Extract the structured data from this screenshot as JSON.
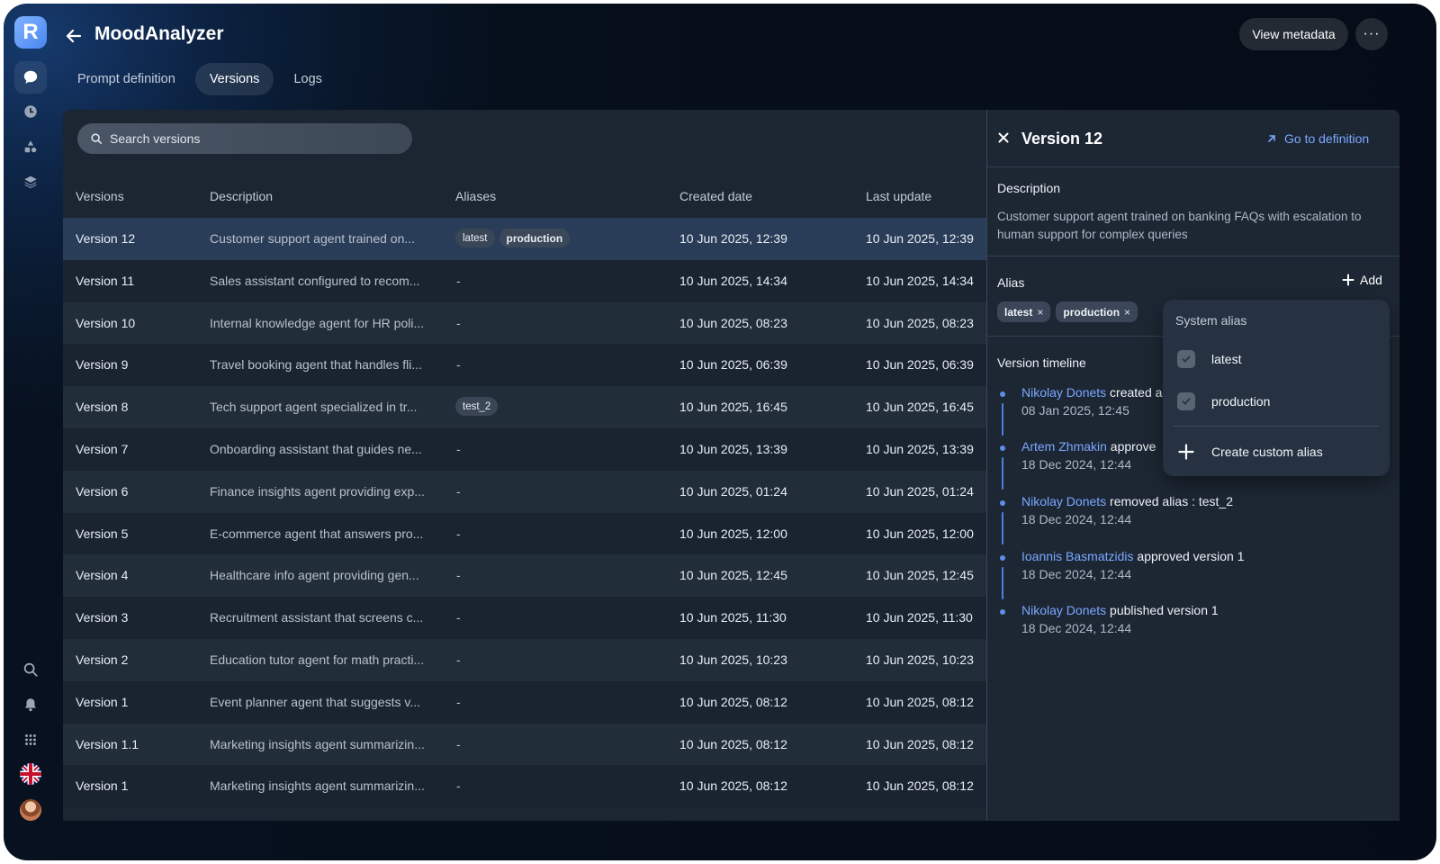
{
  "app": {
    "logo_letter": "R",
    "title": "MoodAnalyzer",
    "view_metadata_label": "View metadata",
    "more_label": "···"
  },
  "tabs": [
    {
      "label": "Prompt definition",
      "active": false
    },
    {
      "label": "Versions",
      "active": true
    },
    {
      "label": "Logs",
      "active": false
    }
  ],
  "search": {
    "placeholder": "Search versions"
  },
  "table": {
    "columns": [
      "Versions",
      "Description",
      "Aliases",
      "Created date",
      "Last update"
    ],
    "rows": [
      {
        "version": "Version 12",
        "description": "Customer support agent trained on...",
        "aliases": [
          "latest",
          "production"
        ],
        "created": "10 Jun 2025, 12:39",
        "updated": "10 Jun 2025, 12:39"
      },
      {
        "version": "Version 11",
        "description": "Sales assistant configured to recom...",
        "aliases": [],
        "created": "10 Jun 2025, 14:34",
        "updated": "10 Jun 2025, 14:34"
      },
      {
        "version": "Version 10",
        "description": "Internal knowledge agent for HR poli...",
        "aliases": [],
        "created": "10 Jun 2025, 08:23",
        "updated": "10 Jun 2025, 08:23"
      },
      {
        "version": "Version 9",
        "description": "Travel booking agent that handles fli...",
        "aliases": [],
        "created": "10 Jun 2025, 06:39",
        "updated": "10 Jun 2025, 06:39"
      },
      {
        "version": "Version 8",
        "description": "Tech support agent specialized in tr...",
        "aliases": [
          "test_2"
        ],
        "created": "10 Jun 2025, 16:45",
        "updated": "10 Jun 2025, 16:45"
      },
      {
        "version": "Version 7",
        "description": "Onboarding assistant that guides ne...",
        "aliases": [],
        "created": "10 Jun 2025, 13:39",
        "updated": "10 Jun 2025, 13:39"
      },
      {
        "version": "Version 6",
        "description": "Finance insights agent providing exp...",
        "aliases": [],
        "created": "10 Jun 2025, 01:24",
        "updated": "10 Jun 2025, 01:24"
      },
      {
        "version": "Version 5",
        "description": "E-commerce agent that answers pro...",
        "aliases": [],
        "created": "10 Jun 2025, 12:00",
        "updated": "10 Jun 2025, 12:00"
      },
      {
        "version": "Version 4",
        "description": "Healthcare info agent providing gen...",
        "aliases": [],
        "created": "10 Jun 2025, 12:45",
        "updated": "10 Jun 2025, 12:45"
      },
      {
        "version": "Version 3",
        "description": "Recruitment assistant that screens c...",
        "aliases": [],
        "created": "10 Jun 2025, 11:30",
        "updated": "10 Jun 2025, 11:30"
      },
      {
        "version": "Version 2",
        "description": "Education tutor agent for math practi...",
        "aliases": [],
        "created": "10 Jun 2025, 10:23",
        "updated": "10 Jun 2025, 10:23"
      },
      {
        "version": "Version 1",
        "description": "Event planner agent that suggests v...",
        "aliases": [],
        "created": "10 Jun 2025, 08:12",
        "updated": "10 Jun 2025, 08:12"
      },
      {
        "version": "Version 1.1",
        "description": "Marketing insights agent summarizin...",
        "aliases": [],
        "created": "10 Jun 2025, 08:12",
        "updated": "10 Jun 2025, 08:12"
      },
      {
        "version": "Version 1",
        "description": "Marketing insights agent summarizin...",
        "aliases": [],
        "created": "10 Jun 2025, 08:12",
        "updated": "10 Jun 2025, 08:12"
      }
    ],
    "empty_alias": "-"
  },
  "detail": {
    "title": "Version 12",
    "go_to_definition": "Go to definition",
    "description_label": "Description",
    "description": "Customer support agent trained on banking FAQs with escalation to human support for complex queries",
    "alias_label": "Alias",
    "add_label": "Add",
    "aliases": [
      "latest",
      "production"
    ],
    "timeline_label": "Version timeline",
    "timeline": [
      {
        "who": "Nikolay Donets",
        "action": " created a",
        "date": "08 Jan 2025, 12:45"
      },
      {
        "who": "Artem Zhmakin",
        "action": " approve",
        "date": "18 Dec 2024, 12:44"
      },
      {
        "who": "Nikolay Donets",
        "action": " removed alias : test_2",
        "date": "18 Dec 2024, 12:44"
      },
      {
        "who": "Ioannis Basmatzidis",
        "action": " approved version 1",
        "date": "18 Dec 2024, 12:44"
      },
      {
        "who": "Nikolay Donets",
        "action": " published version 1",
        "date": "18 Dec 2024, 12:44"
      }
    ]
  },
  "alias_dropdown": {
    "header": "System alias",
    "options": [
      {
        "label": "latest",
        "checked": true
      },
      {
        "label": "production",
        "checked": true
      }
    ],
    "create_label": "Create custom alias"
  },
  "rail_icons": [
    "chat-icon",
    "clock-icon",
    "shapes-icon",
    "layers-icon",
    "search-icon",
    "bell-icon",
    "grid-icon"
  ],
  "colors": {
    "accent": "#7aa7ff",
    "selected_row": "#2a3d58",
    "panel": "#1c2633"
  }
}
